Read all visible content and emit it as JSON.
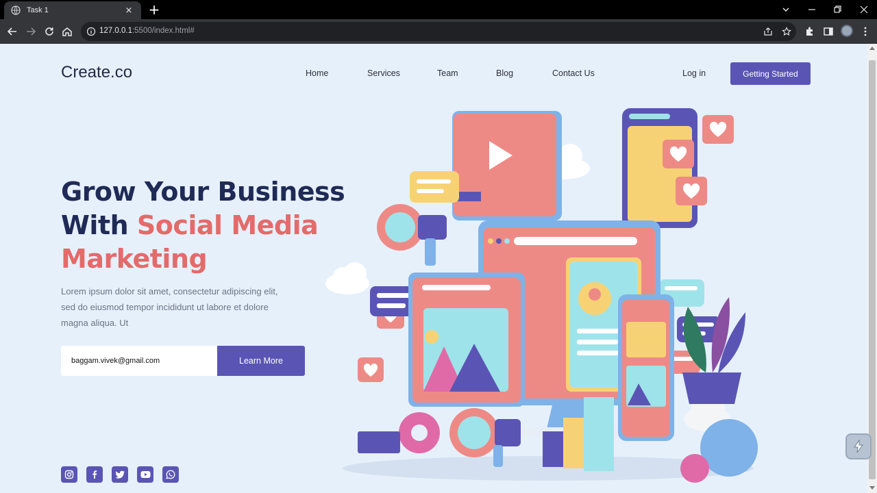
{
  "browser": {
    "tab_title": "Task 1",
    "new_tab_glyph": "+",
    "tab_close_glyph": "×",
    "url_host": "127.0.0.1",
    "url_rest": ":5500/index.html#"
  },
  "site": {
    "logo": "Create.co",
    "nav": [
      "Home",
      "Services",
      "Team",
      "Blog",
      "Contact Us"
    ],
    "login": "Log in",
    "cta": "Getting Started"
  },
  "hero": {
    "headline_line1": "Grow Your Business",
    "headline_with": "With ",
    "headline_accent1": "Social Media",
    "headline_accent2": "Marketing",
    "lead": "Lorem ipsum dolor sit amet, consectetur adipiscing elit, sed do eiusmod tempor incididunt ut labore et dolore magna aliqua. Ut",
    "email_value": "baggam.vivek@gmail.com",
    "button": "Learn More"
  },
  "socials": [
    "instagram-icon",
    "facebook-icon",
    "twitter-icon",
    "youtube-icon",
    "whatsapp-icon"
  ],
  "colors": {
    "page_bg": "#e6f0fb",
    "primary": "#5a55b4",
    "accent": "#e56a6a",
    "heading": "#1f2a56"
  }
}
